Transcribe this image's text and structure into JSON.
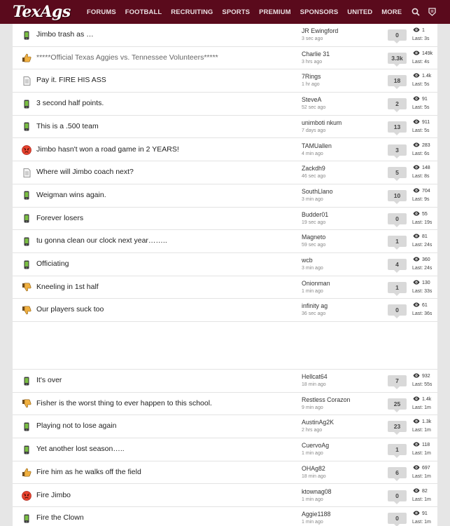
{
  "header": {
    "logo_text": "TexAgs",
    "nav": [
      "FORUMS",
      "FOOTBALL",
      "RECRUITING",
      "SPORTS",
      "PREMIUM",
      "SPONSORS",
      "UNITED",
      "MORE"
    ],
    "brand_color": "#5a0a1c"
  },
  "threads_top": [
    {
      "icon": "phone-icon",
      "title": "Jimbo trash as …",
      "author": "JR Ewingford",
      "age": "3 sec ago",
      "replies": "0",
      "views": "1",
      "last": "Last: 3s"
    },
    {
      "icon": "thumbs-up-icon",
      "title": "*****Official Texas Aggies vs. Tennessee Volunteers*****",
      "muted": true,
      "author": "Charlie 31",
      "age": "3 hrs ago",
      "replies": "3.3k",
      "views": "149k",
      "last": "Last: 4s"
    },
    {
      "icon": "document-icon",
      "title": "Pay it. FIRE HIS ASS",
      "author": "7Rings",
      "age": "1 hr ago",
      "replies": "18",
      "views": "1.4k",
      "last": "Last: 5s"
    },
    {
      "icon": "phone-icon",
      "title": "3 second half points.",
      "author": "SteveA",
      "age": "52 sec ago",
      "replies": "2",
      "views": "91",
      "last": "Last: 5s"
    },
    {
      "icon": "phone-icon",
      "title": "This is a .500 team",
      "author": "unimboti nkum",
      "age": "7 days ago",
      "replies": "13",
      "views": "911",
      "last": "Last: 5s"
    },
    {
      "icon": "angry-face-icon",
      "title": "Jimbo hasn't won a road game in 2 YEARS!",
      "author": "TAMUallen",
      "age": "4 min ago",
      "replies": "3",
      "views": "283",
      "last": "Last: 6s"
    },
    {
      "icon": "document-icon",
      "title": "Where will Jimbo coach next?",
      "author": "Zackdh9",
      "age": "46 sec ago",
      "replies": "5",
      "views": "148",
      "last": "Last: 8s"
    },
    {
      "icon": "phone-icon",
      "title": "Weigman wins again.",
      "author": "SouthLlano",
      "age": "3 min ago",
      "replies": "10",
      "views": "704",
      "last": "Last: 9s"
    },
    {
      "icon": "phone-icon",
      "title": "Forever losers",
      "author": "Budder01",
      "age": "19 sec ago",
      "replies": "0",
      "views": "55",
      "last": "Last: 19s"
    },
    {
      "icon": "phone-icon",
      "title": "tu gonna clean our clock next year……..",
      "author": "Magneto",
      "age": "59 sec ago",
      "replies": "1",
      "views": "81",
      "last": "Last: 24s"
    },
    {
      "icon": "phone-icon",
      "title": "Officiating",
      "author": "wcb",
      "age": "3 min ago",
      "replies": "4",
      "views": "360",
      "last": "Last: 24s"
    },
    {
      "icon": "thumbs-down-icon",
      "title": "Kneeling in 1st half",
      "author": "Onionman",
      "age": "1 min ago",
      "replies": "1",
      "views": "130",
      "last": "Last: 33s"
    },
    {
      "icon": "thumbs-down-icon",
      "title": "Our players suck too",
      "author": "infinity ag",
      "age": "36 sec ago",
      "replies": "0",
      "views": "61",
      "last": "Last: 36s"
    }
  ],
  "threads_bottom": [
    {
      "icon": "phone-icon",
      "title": "It's over",
      "author": "Hellcat64",
      "age": "18 min ago",
      "replies": "7",
      "views": "932",
      "last": "Last: 55s"
    },
    {
      "icon": "thumbs-down-icon",
      "title": "Fisher is the worst thing to ever happen to this school.",
      "author": "Restless Corazon",
      "age": "9 min ago",
      "replies": "25",
      "views": "1.4k",
      "last": "Last: 1m"
    },
    {
      "icon": "phone-icon",
      "title": "Playing not to lose again",
      "author": "AustinAg2K",
      "age": "2 hrs ago",
      "replies": "23",
      "views": "1.3k",
      "last": "Last: 1m"
    },
    {
      "icon": "phone-icon",
      "title": "Yet another lost season…..",
      "author": "CuervoAg",
      "age": "1 min ago",
      "replies": "1",
      "views": "118",
      "last": "Last: 1m"
    },
    {
      "icon": "thumbs-up-icon",
      "title": "Fire him as he walks off the field",
      "author": "OHAg82",
      "age": "18 min ago",
      "replies": "6",
      "views": "697",
      "last": "Last: 1m"
    },
    {
      "icon": "angry-face-icon",
      "title": "Fire Jimbo",
      "author": "ktownag08",
      "age": "1 min ago",
      "replies": "0",
      "views": "82",
      "last": "Last: 1m"
    },
    {
      "icon": "phone-icon",
      "title": "Fire the Clown",
      "author": "Aggie1188",
      "age": "1 min ago",
      "replies": "0",
      "views": "91",
      "last": "Last: 1m"
    }
  ]
}
